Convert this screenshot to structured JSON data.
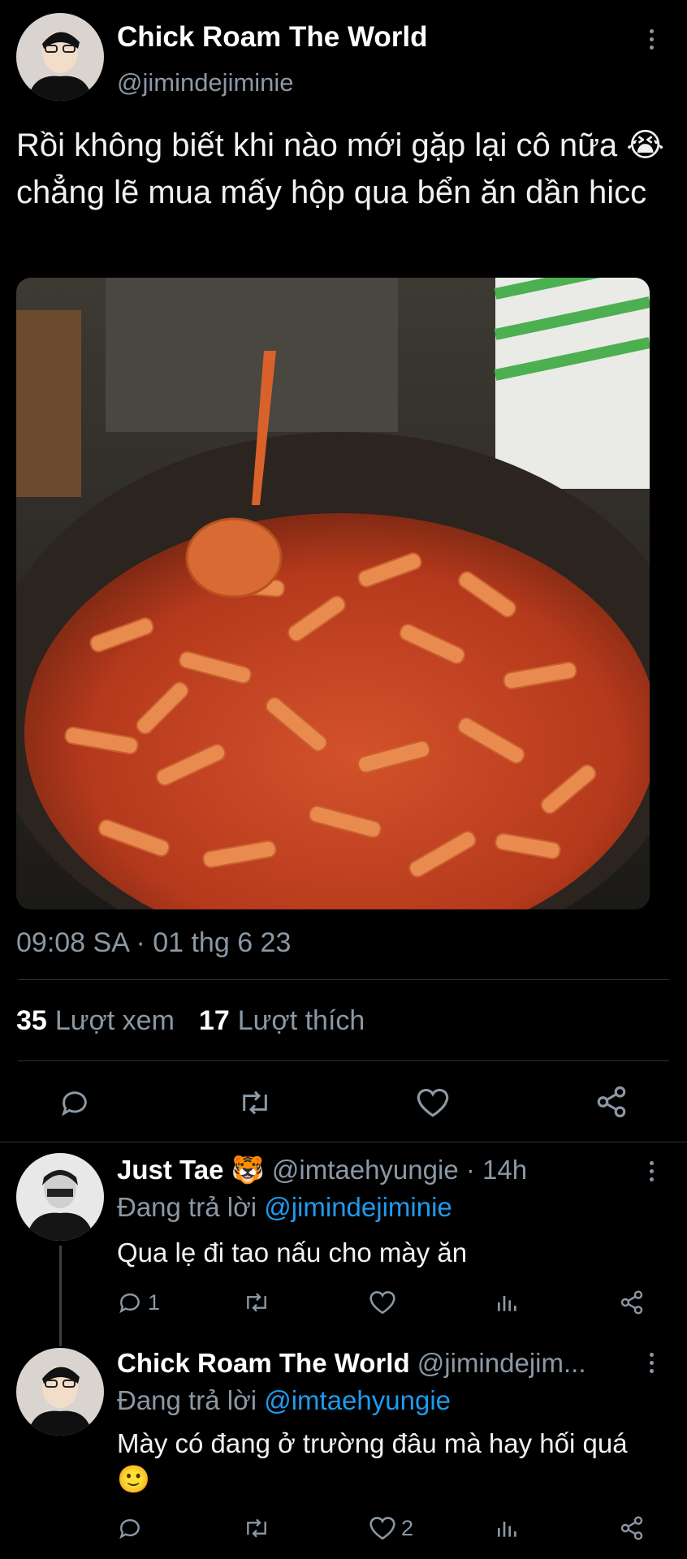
{
  "main_tweet": {
    "author_name": "Chick Roam The World",
    "handle": "@jimindejiminie",
    "text": "Rồi không biết khi nào mới gặp lại cô nữa 😭 chẳng lẽ mua mấy hộp qua bển ăn dần hicc",
    "timestamp": "09:08 SA · 01 thg 6 23",
    "views_count": "35",
    "views_label": "Lượt xem",
    "likes_count": "17",
    "likes_label": "Lượt thích"
  },
  "replies": [
    {
      "author_name": "Just Tae 🐯",
      "handle": "@imtaehyungie",
      "time": "· 14h",
      "replying_prefix": "Đang trả lời",
      "replying_to": "@jimindejiminie",
      "text": "Qua lẹ đi tao nấu cho mày ăn",
      "reply_count": "1",
      "like_count": ""
    },
    {
      "author_name": "Chick Roam The World",
      "handle": "@jimindejim...",
      "replying_prefix": "Đang trả lời",
      "replying_to": "@imtaehyungie",
      "text": "Mày có đang ở trường đâu mà hay hối quá 🙂",
      "reply_count": "",
      "like_count": "2"
    }
  ],
  "colors": {
    "background": "#000000",
    "muted": "#8b98a5",
    "link": "#1d9bf0",
    "divider": "#2f3336"
  }
}
